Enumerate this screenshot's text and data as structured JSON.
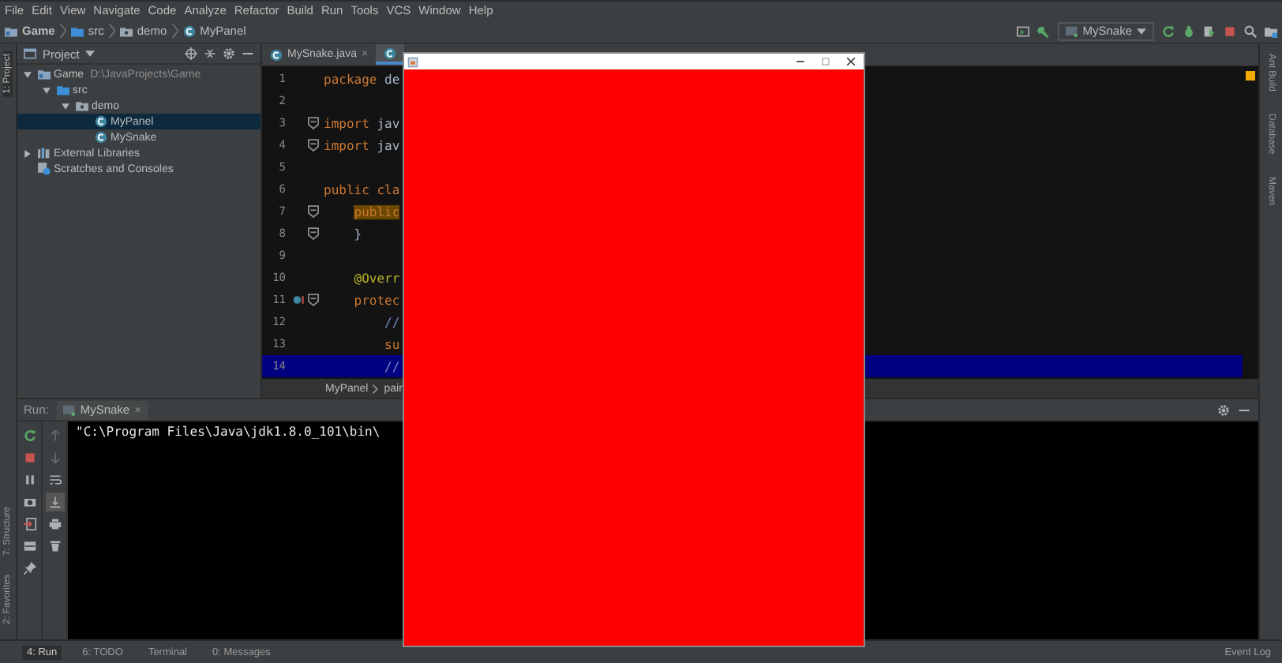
{
  "menu": [
    "File",
    "Edit",
    "View",
    "Navigate",
    "Code",
    "Analyze",
    "Refactor",
    "Build",
    "Run",
    "Tools",
    "VCS",
    "Window",
    "Help"
  ],
  "breadcrumb": [
    {
      "label": "Game",
      "kind": "module"
    },
    {
      "label": "src",
      "kind": "folder"
    },
    {
      "label": "demo",
      "kind": "package"
    },
    {
      "label": "MyPanel",
      "kind": "class"
    }
  ],
  "run_config": "MySnake",
  "left_stripe_top": [
    {
      "label": "1: Project",
      "selected": true
    }
  ],
  "left_stripe_bottom": [
    {
      "label": "7: Structure",
      "selected": false
    },
    {
      "label": "2: Favorites",
      "selected": false
    }
  ],
  "right_stripe": [
    "Ant Build",
    "Database",
    "Maven"
  ],
  "project": {
    "title": "Project",
    "tree": [
      {
        "label": "Game",
        "path": "D:\\JavaProjects\\Game",
        "kind": "module",
        "expanded": true,
        "selected": false,
        "children": [
          {
            "label": "src",
            "kind": "folder",
            "expanded": true,
            "selected": false,
            "children": [
              {
                "label": "demo",
                "kind": "package",
                "expanded": true,
                "selected": false,
                "children": [
                  {
                    "label": "MyPanel",
                    "kind": "class",
                    "selected": true
                  },
                  {
                    "label": "MySnake",
                    "kind": "class",
                    "selected": false
                  }
                ]
              }
            ]
          }
        ]
      },
      {
        "label": "External Libraries",
        "kind": "library",
        "expanded": false,
        "selected": false
      },
      {
        "label": "Scratches and Consoles",
        "kind": "scratch",
        "selected": false
      }
    ]
  },
  "editor_tabs": [
    {
      "label": "MySnake.java",
      "selected": false,
      "close": "×"
    },
    {
      "selected": true
    }
  ],
  "code": [
    {
      "n": "1",
      "fold": false,
      "override": false,
      "current": false,
      "tokens": [
        {
          "t": "package ",
          "kind": "keyword"
        },
        {
          "t": "de",
          "kind": "plain"
        }
      ]
    },
    {
      "n": "2",
      "fold": false,
      "override": false,
      "current": false
    },
    {
      "n": "3",
      "fold": true,
      "override": false,
      "current": false,
      "tokens": [
        {
          "t": "import ",
          "kind": "keyword"
        },
        {
          "t": "jav",
          "kind": "plain"
        }
      ]
    },
    {
      "n": "4",
      "fold": true,
      "override": false,
      "current": false,
      "tokens": [
        {
          "t": "import ",
          "kind": "keyword"
        },
        {
          "t": "jav",
          "kind": "plain"
        }
      ]
    },
    {
      "n": "5",
      "fold": false,
      "override": false,
      "current": false
    },
    {
      "n": "6",
      "fold": false,
      "override": false,
      "current": false,
      "tokens": [
        {
          "t": "public cla",
          "kind": "keyword"
        }
      ],
      "children": [
        {
          "n": "7",
          "fold": true,
          "override": false,
          "current": false,
          "tokens": [
            {
              "t": "public",
              "kind": "highlight"
            }
          ]
        },
        {
          "n": "8",
          "fold": true,
          "override": false,
          "current": false,
          "tokens": [
            {
              "t": "}",
              "kind": "plain"
            }
          ]
        },
        {
          "n": "9",
          "fold": false,
          "override": false,
          "current": false
        },
        {
          "n": "10",
          "fold": false,
          "override": false,
          "current": false,
          "tokens": [
            {
              "t": "@Overr",
              "kind": "annotation"
            }
          ]
        },
        {
          "n": "11",
          "fold": true,
          "override": true,
          "current": false,
          "tokens": [
            {
              "t": "protec",
              "kind": "keyword"
            }
          ],
          "children": [
            {
              "n": "12",
              "fold": false,
              "override": false,
              "current": false,
              "tokens": [
                {
                  "t": "//",
                  "kind": "comment"
                }
              ]
            },
            {
              "n": "13",
              "fold": false,
              "override": false,
              "current": false,
              "tokens": [
                {
                  "t": "su",
                  "kind": "keyword"
                }
              ]
            },
            {
              "n": "14",
              "fold": false,
              "override": false,
              "current": true,
              "tokens": [
                {
                  "t": "//",
                  "kind": "comment"
                }
              ]
            }
          ]
        }
      ]
    }
  ],
  "editor_breadcrumb": [
    "MyPanel",
    "pain"
  ],
  "run": {
    "title": "Run:",
    "tab": {
      "label": "MySnake",
      "close": "×"
    },
    "console": [
      "\"C:\\Program Files\\Java\\jdk1.8.0_101\\bin\\"
    ]
  },
  "bottom_tabs": [
    {
      "label": "4: Run",
      "selected": true
    },
    {
      "label": "6: TODO",
      "selected": false
    },
    {
      "label": "Terminal",
      "selected": false
    },
    {
      "label": "0: Messages",
      "selected": false
    }
  ],
  "event_log": "Event Log"
}
